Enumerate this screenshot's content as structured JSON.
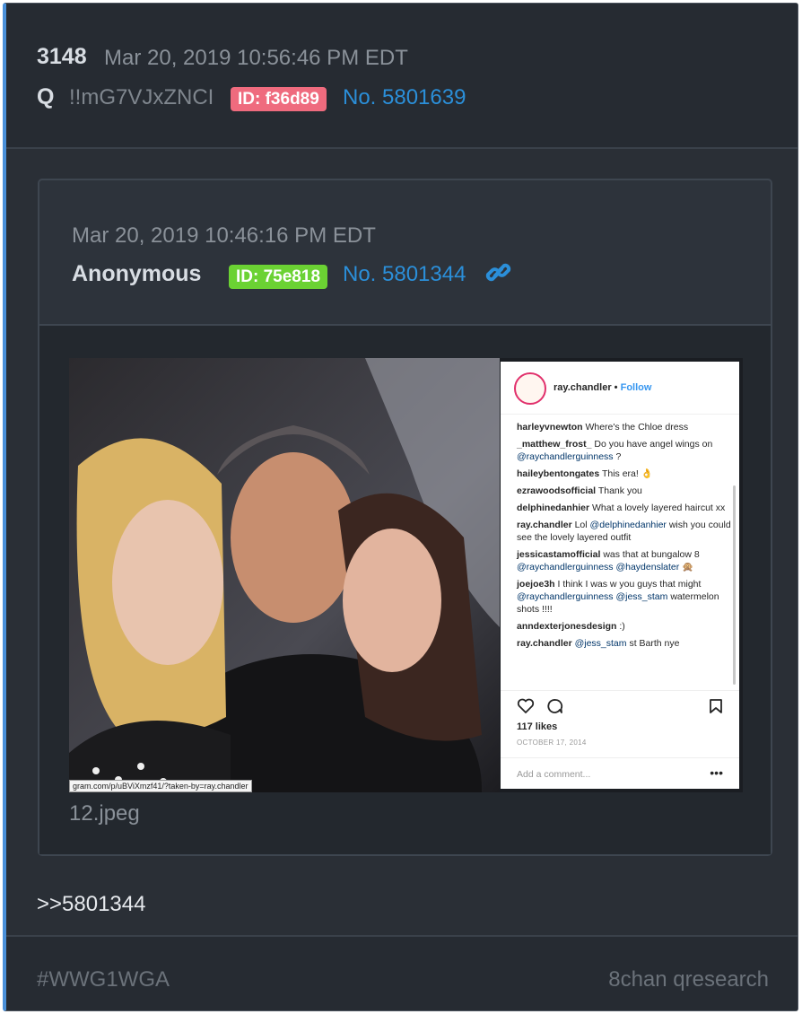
{
  "post": {
    "number": "3148",
    "date": "Mar 20, 2019 10:56:46 PM EDT",
    "author": "Q",
    "tripcode": "!!mG7VJxZNCI",
    "id_badge": "ID: f36d89",
    "post_no": "No. 5801639",
    "reply_text": ">>5801344"
  },
  "quoted": {
    "date": "Mar 20, 2019 10:46:16 PM EDT",
    "author": "Anonymous",
    "id_badge": "ID: 75e818",
    "post_no": "No. 5801344",
    "filename": "12.jpeg",
    "image": {
      "url_bar": "gram.com/p/uBViXmzf41/?taken-by=ray.chandler",
      "ig_user": "ray.chandler",
      "ig_dot": "•",
      "ig_follow": "Follow",
      "comments": [
        {
          "user": "harleyvnewton",
          "text": "Where's the Chloe dress"
        },
        {
          "user": "_matthew_frost_",
          "text": "Do you have angel wings on",
          "mention": "@raychandlerguinness",
          "after": "?"
        },
        {
          "user": "haileybentongates",
          "text": "This era! 👌"
        },
        {
          "user": "ezrawoodsofficial",
          "text": "Thank you"
        },
        {
          "user": "delphinedanhier",
          "text": "What a lovely layered haircut xx"
        },
        {
          "user": "ray.chandler",
          "text": "Lol",
          "mention": "@delphinedanhier",
          "after": "wish you could see the lovely layered outfit"
        },
        {
          "user": "jessicastamofficial",
          "text": "was that at bungalow 8",
          "mention": "@raychandlerguinness @haydenslater",
          "after": "🙊"
        },
        {
          "user": "joejoe3h",
          "text": "I think I was w you guys that might",
          "mention": "@raychandlerguinness @jess_stam",
          "after": "watermelon shots !!!!"
        },
        {
          "user": "anndexterjonesdesign",
          "text": ":)"
        },
        {
          "user": "ray.chandler",
          "text": "",
          "mention": "@jess_stam",
          "after": "st Barth nye"
        }
      ],
      "likes": "117 likes",
      "date": "OCTOBER 17, 2014",
      "add_comment": "Add a comment...",
      "more": "•••"
    }
  },
  "footer": {
    "tag": "#WWG1WGA",
    "source": "8chan qresearch"
  },
  "colors": {
    "accent": "#4a90d9",
    "link": "#2b8fd9",
    "id_red": "#ef6b7e",
    "id_green": "#6bd233",
    "background": "#2a2f36"
  },
  "icons": [
    "link-icon",
    "heart-icon",
    "comment-icon",
    "bookmark-icon"
  ]
}
